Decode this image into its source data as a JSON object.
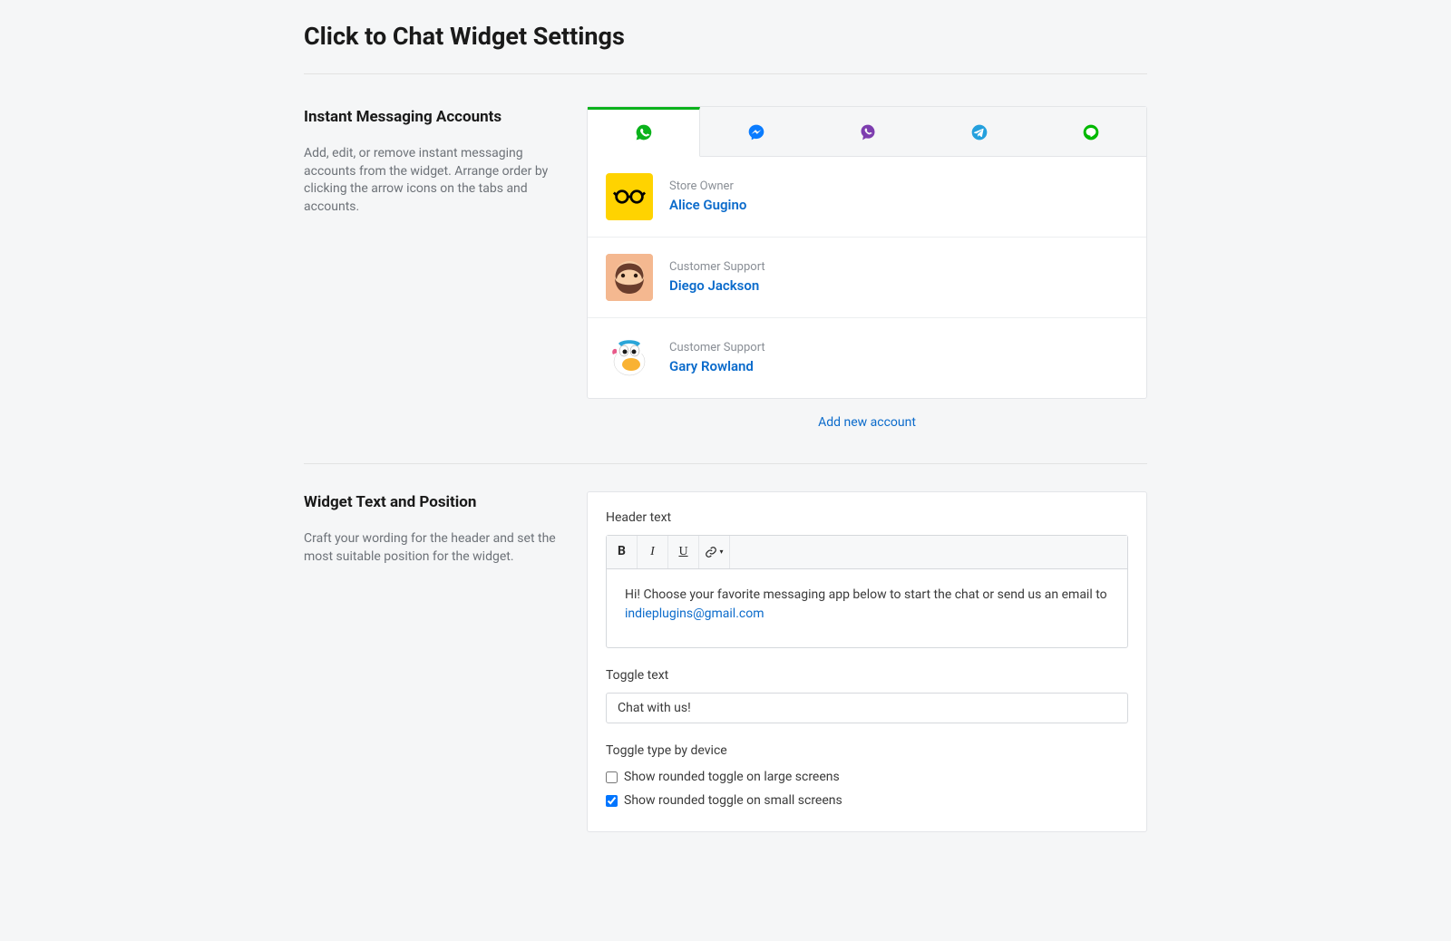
{
  "page": {
    "title": "Click to Chat Widget Settings"
  },
  "sections": {
    "accounts": {
      "heading": "Instant Messaging Accounts",
      "description": "Add, edit, or remove instant messaging accounts from the widget. Arrange order by clicking the arrow icons on the tabs and accounts.",
      "tabs": [
        {
          "id": "whatsapp",
          "color": "#0ab21b",
          "active": true
        },
        {
          "id": "messenger",
          "color": "#0a7cff",
          "active": false
        },
        {
          "id": "viber",
          "color": "#7d3daf",
          "active": false
        },
        {
          "id": "telegram",
          "color": "#24a0dd",
          "active": false
        },
        {
          "id": "line",
          "color": "#00b900",
          "active": false
        }
      ],
      "list": [
        {
          "role": "Store Owner",
          "name": "Alice Gugino"
        },
        {
          "role": "Customer Support",
          "name": "Diego Jackson"
        },
        {
          "role": "Customer Support",
          "name": "Gary Rowland"
        }
      ],
      "add_label": "Add new account"
    },
    "widget_text": {
      "heading": "Widget Text and Position",
      "description": "Craft your wording for the header and set the most suitable position for the widget.",
      "header_text_label": "Header text",
      "header_text_value": "Hi! Choose your favorite messaging app below to start the chat or send us an email to ",
      "header_text_email": "indieplugins@gmail.com",
      "toggle_text_label": "Toggle text",
      "toggle_text_value": "Chat with us!",
      "toggle_type_label": "Toggle type by device",
      "checkbox_large_label": "Show rounded toggle on large screens",
      "checkbox_large_checked": false,
      "checkbox_small_label": "Show rounded toggle on small screens",
      "checkbox_small_checked": true
    }
  }
}
